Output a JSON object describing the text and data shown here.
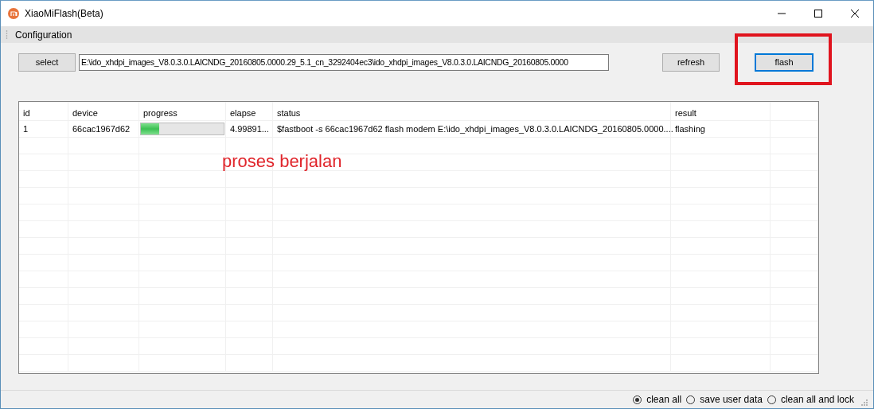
{
  "window": {
    "title": "XiaoMiFlash(Beta)"
  },
  "menu": [
    "Configuration"
  ],
  "toolbar": {
    "select_button": "select",
    "path": "E:\\ido_xhdpi_images_V8.0.3.0.LAICNDG_20160805.0000.29_5.1_cn_3292404ec3\\ido_xhdpi_images_V8.0.3.0.LAICNDG_20160805.0000",
    "refresh_button": "refresh",
    "flash_button": "flash"
  },
  "table": {
    "columns": [
      "id",
      "device",
      "progress",
      "elapse",
      "status",
      "result"
    ],
    "rows": [
      {
        "id": "1",
        "device": "66cac1967d62",
        "level": 0.22,
        "elapse": "4.99891...",
        "status": "$fastboot -s 66cac1967d62 flash modem E:\\ido_xhdpi_images_V8.0.3.0.LAICNDG_20160805.0000....",
        "result": "flashing"
      }
    ]
  },
  "annotation": {
    "text": "proses berjalan"
  },
  "status_bar": {
    "options": [
      {
        "label": "clean all",
        "selected": true
      },
      {
        "label": "save user data",
        "selected": false
      },
      {
        "label": "clean all and lock",
        "selected": false
      }
    ]
  }
}
